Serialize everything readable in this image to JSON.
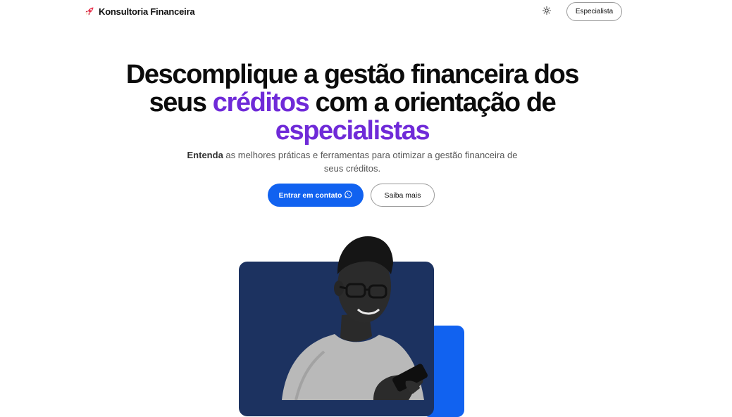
{
  "header": {
    "brand_name": "Konsultoria Financeira",
    "brand_icon": "rocket-icon",
    "theme_icon": "sun-icon",
    "specialist_button": "Especialista"
  },
  "hero": {
    "title_part1": "Descomplique a gestão financeira dos seus ",
    "title_accent1": "créditos",
    "title_part2": " com a orientação de ",
    "title_accent2": "especialistas",
    "subtitle_bold": "Entenda",
    "subtitle_rest": " as melhores práticas e ferramentas para otimizar a gestão financeira de seus créditos.",
    "primary_button": "Entrar em contato",
    "primary_button_icon": "whatsapp-icon",
    "secondary_button": "Saiba mais"
  },
  "colors": {
    "accent_purple": "#6f2ad8",
    "primary_blue": "#1162f0",
    "navy": "#1c3260"
  }
}
